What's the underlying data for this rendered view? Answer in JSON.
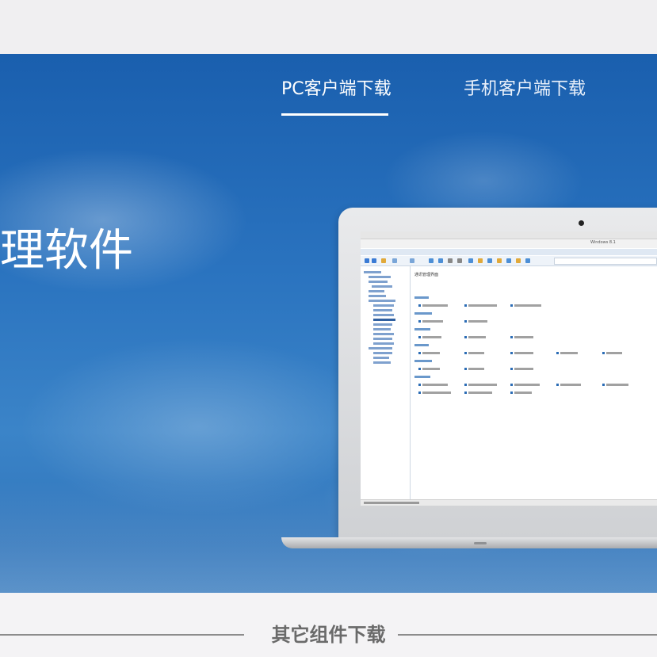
{
  "nav": {
    "tabs": [
      {
        "label": "PC客户端下载",
        "active": true
      },
      {
        "label": "手机客户端下载",
        "active": false
      }
    ]
  },
  "hero": {
    "title": "理软件"
  },
  "laptop_screen": {
    "window_title": "Windows 8.1",
    "main_heading": "通讯管理界面"
  },
  "section": {
    "title": "其它组件下载"
  },
  "colors": {
    "hero_blue": "#2a73bf",
    "accent_white": "#ffffff",
    "section_title_gray": "#6a6a6a"
  }
}
